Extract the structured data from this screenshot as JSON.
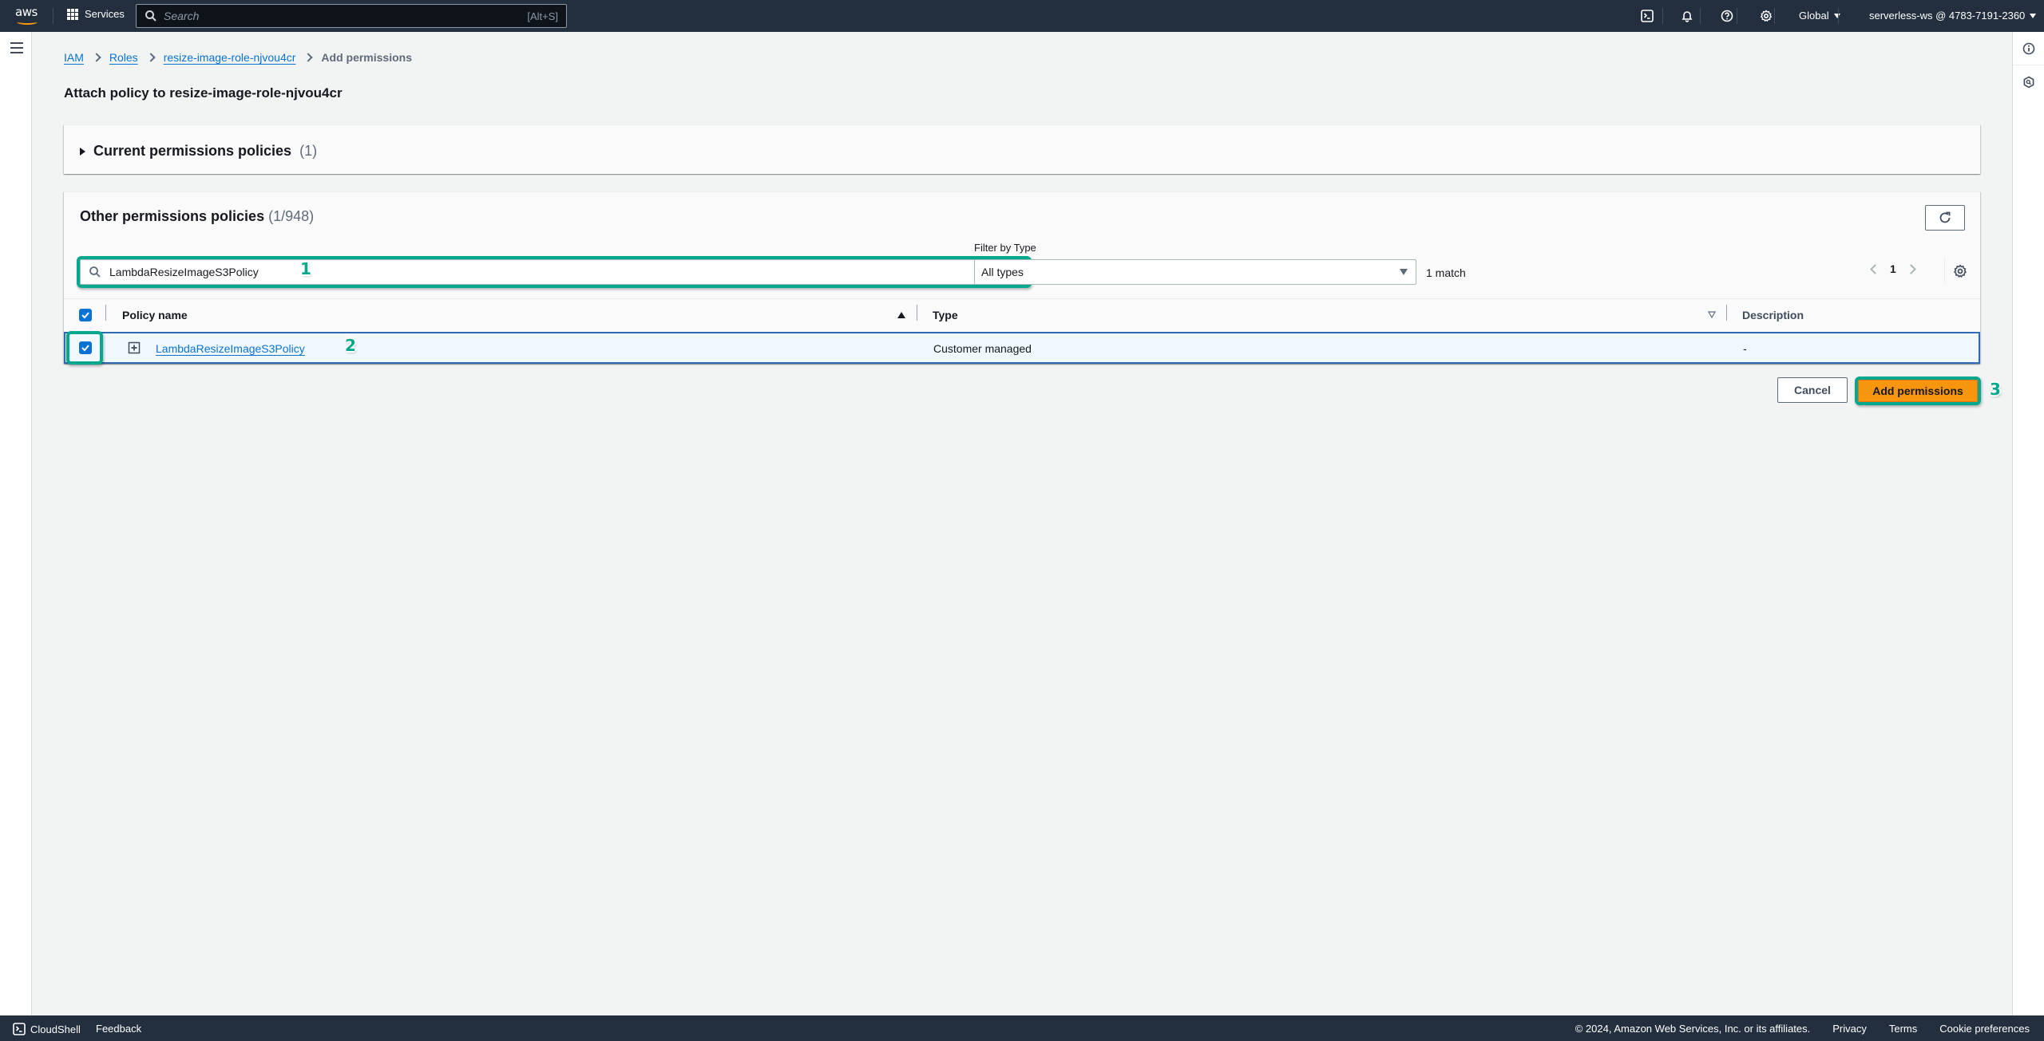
{
  "topnav": {
    "logo": "aws",
    "services_label": "Services",
    "search_placeholder": "Search",
    "search_shortcut": "[Alt+S]",
    "region": "Global",
    "account": "serverless-ws @ 4783-7191-2360"
  },
  "breadcrumb": {
    "items": [
      {
        "label": "IAM"
      },
      {
        "label": "Roles"
      },
      {
        "label": "resize-image-role-njvou4cr"
      }
    ],
    "current": "Add permissions"
  },
  "page_title": "Attach policy to resize-image-role-njvou4cr",
  "current_policies": {
    "title": "Current permissions policies",
    "count": "(1)"
  },
  "other_policies": {
    "title": "Other permissions policies",
    "count": "(1/948)",
    "search_value": "LambdaResizeImageS3Policy",
    "filter_label": "Filter by Type",
    "filter_value": "All types",
    "match_text": "1 match",
    "page": "1",
    "columns": [
      "Policy name",
      "Type",
      "Description"
    ],
    "rows": [
      {
        "name": "LambdaResizeImageS3Policy",
        "type": "Customer managed",
        "description": "-",
        "selected": true
      }
    ]
  },
  "actions": {
    "cancel": "Cancel",
    "add": "Add permissions"
  },
  "annotations": [
    "1",
    "2",
    "3"
  ],
  "footer": {
    "cloudshell": "CloudShell",
    "feedback": "Feedback",
    "copyright": "© 2024, Amazon Web Services, Inc. or its affiliates.",
    "privacy": "Privacy",
    "terms": "Terms",
    "cookies": "Cookie preferences"
  },
  "colors": {
    "nav_bg": "#232f3e",
    "link": "#0972d3",
    "primary_button": "#f7950e",
    "highlight": "#01a88d",
    "selected_row_bg": "#f1f8ff",
    "selected_row_border": "#2e6bb4"
  }
}
